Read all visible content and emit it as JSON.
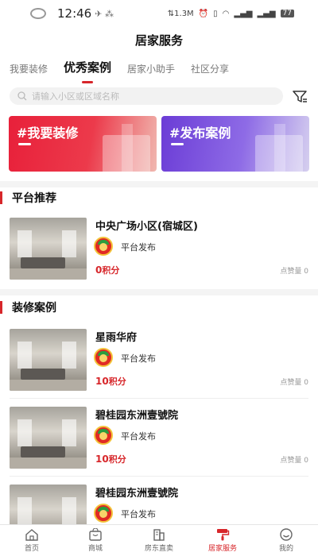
{
  "status_bar": {
    "time": "12:46",
    "speed": "1.3M",
    "battery": "77"
  },
  "header": {
    "title": "居家服务"
  },
  "tabs": [
    {
      "label": "我要装修"
    },
    {
      "label": "优秀案例"
    },
    {
      "label": "居家小助手"
    },
    {
      "label": "社区分享"
    }
  ],
  "search": {
    "placeholder": "请输入小区或区域名称"
  },
  "banners": [
    {
      "label": "#我要装修",
      "color": "#e8203a"
    },
    {
      "label": "#发布案例",
      "color": "#6b3cd6"
    }
  ],
  "sections": {
    "recommend": {
      "title": "平台推荐"
    },
    "cases": {
      "title": "装修案例"
    }
  },
  "recommend_items": [
    {
      "name": "中央广场小区(宿城区)",
      "publisher": "平台发布",
      "points": "0",
      "points_unit": "积分",
      "likes": "点赞量 0"
    }
  ],
  "case_items": [
    {
      "name": "星雨华府",
      "publisher": "平台发布",
      "points": "10",
      "points_unit": "积分",
      "likes": "点赞量 0"
    },
    {
      "name": "碧桂园东洲壹號院",
      "publisher": "平台发布",
      "points": "10",
      "points_unit": "积分",
      "likes": "点赞量 0"
    },
    {
      "name": "碧桂园东洲壹號院",
      "publisher": "平台发布",
      "points": "",
      "points_unit": "",
      "likes": ""
    }
  ],
  "bottom_nav": [
    {
      "label": "首页"
    },
    {
      "label": "商城"
    },
    {
      "label": "房东直卖"
    },
    {
      "label": "居家服务"
    },
    {
      "label": "我的"
    }
  ],
  "accent_color": "#d7262a"
}
